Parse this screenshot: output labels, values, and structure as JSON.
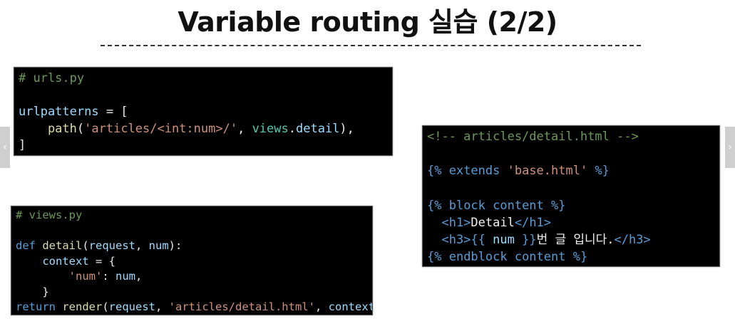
{
  "title": "Variable routing 실습 (2/2)",
  "nav": {
    "prev_glyph": "‹",
    "next_glyph": "›"
  },
  "urls_block": {
    "lines": [
      [
        {
          "t": "# urls.py",
          "c": "c-comment"
        }
      ],
      [],
      [
        {
          "t": "urlpatterns",
          "c": "c-ident"
        },
        {
          "t": " = [",
          "c": "c-punc"
        }
      ],
      [
        {
          "t": "    path",
          "c": "c-func"
        },
        {
          "t": "(",
          "c": "c-punc"
        },
        {
          "t": "'articles/<int:num>/'",
          "c": "c-str"
        },
        {
          "t": ", ",
          "c": "c-punc"
        },
        {
          "t": "views",
          "c": "c-ident2"
        },
        {
          "t": ".",
          "c": "c-punc"
        },
        {
          "t": "detail",
          "c": "c-ident"
        },
        {
          "t": "),",
          "c": "c-punc"
        }
      ],
      [
        {
          "t": "]",
          "c": "c-punc"
        }
      ]
    ]
  },
  "views_block": {
    "lines": [
      [
        {
          "t": "# views.py",
          "c": "c-comment"
        }
      ],
      [],
      [
        {
          "t": "def ",
          "c": "c-keyword"
        },
        {
          "t": "detail",
          "c": "c-func"
        },
        {
          "t": "(",
          "c": "c-punc"
        },
        {
          "t": "request",
          "c": "c-ident"
        },
        {
          "t": ", ",
          "c": "c-punc"
        },
        {
          "t": "num",
          "c": "c-ident"
        },
        {
          "t": "):",
          "c": "c-punc"
        }
      ],
      [
        {
          "t": "    context",
          "c": "c-ident"
        },
        {
          "t": " = {",
          "c": "c-punc"
        }
      ],
      [
        {
          "t": "        ",
          "c": "c-punc"
        },
        {
          "t": "'num'",
          "c": "c-str"
        },
        {
          "t": ": ",
          "c": "c-punc"
        },
        {
          "t": "num",
          "c": "c-ident"
        },
        {
          "t": ",",
          "c": "c-punc"
        }
      ],
      [
        {
          "t": "    }",
          "c": "c-punc"
        }
      ],
      [
        {
          "t": "return ",
          "c": "c-keyword"
        },
        {
          "t": "render",
          "c": "c-func"
        },
        {
          "t": "(",
          "c": "c-punc"
        },
        {
          "t": "request",
          "c": "c-ident"
        },
        {
          "t": ", ",
          "c": "c-punc"
        },
        {
          "t": "'articles/detail.html'",
          "c": "c-str"
        },
        {
          "t": ", ",
          "c": "c-punc"
        },
        {
          "t": "context",
          "c": "c-ident"
        },
        {
          "t": ")",
          "c": "c-punc"
        }
      ]
    ]
  },
  "template_block": {
    "lines": [
      [
        {
          "t": "<!-- articles/detail.html -->",
          "c": "c-comment"
        }
      ],
      [],
      [
        {
          "t": "{% ",
          "c": "c-tmpl"
        },
        {
          "t": "extends ",
          "c": "c-keyword"
        },
        {
          "t": "'base.html'",
          "c": "c-str"
        },
        {
          "t": " %}",
          "c": "c-tmpl"
        }
      ],
      [],
      [
        {
          "t": "{% ",
          "c": "c-tmpl"
        },
        {
          "t": "block content",
          "c": "c-keyword"
        },
        {
          "t": " %}",
          "c": "c-tmpl"
        }
      ],
      [
        {
          "t": "  <h1>",
          "c": "c-tag"
        },
        {
          "t": "Detail",
          "c": "c-text"
        },
        {
          "t": "</h1>",
          "c": "c-tag"
        }
      ],
      [
        {
          "t": "  <h3>",
          "c": "c-tag"
        },
        {
          "t": "{{ ",
          "c": "c-tmpl"
        },
        {
          "t": "num",
          "c": "c-ident"
        },
        {
          "t": " }}",
          "c": "c-tmpl"
        },
        {
          "t": "번 글 입니다.",
          "c": "c-text"
        },
        {
          "t": "</h3>",
          "c": "c-tag"
        }
      ],
      [
        {
          "t": "{% ",
          "c": "c-tmpl"
        },
        {
          "t": "endblock content",
          "c": "c-keyword"
        },
        {
          "t": " %}",
          "c": "c-tmpl"
        }
      ]
    ]
  }
}
